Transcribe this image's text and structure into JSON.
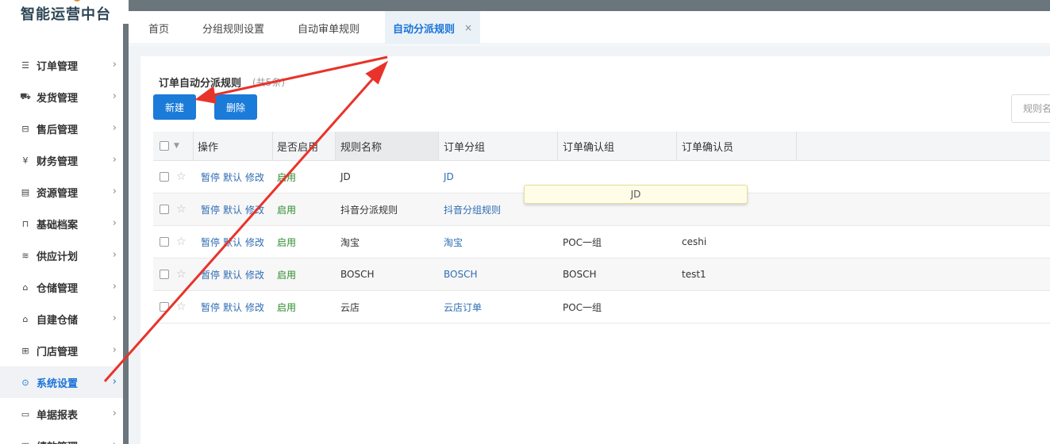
{
  "app": {
    "title": "智能运营中台"
  },
  "sidebar": {
    "items": [
      {
        "label": "订单管理",
        "icon": "order-list-icon",
        "glyph": "☰"
      },
      {
        "label": "发货管理",
        "icon": "truck-icon",
        "glyph": "⛟"
      },
      {
        "label": "售后管理",
        "icon": "after-sales-icon",
        "glyph": "⊟"
      },
      {
        "label": "财务管理",
        "icon": "yen-icon",
        "glyph": "¥"
      },
      {
        "label": "资源管理",
        "icon": "resource-icon",
        "glyph": "▤"
      },
      {
        "label": "基础档案",
        "icon": "archive-box-icon",
        "glyph": "⊓"
      },
      {
        "label": "供应计划",
        "icon": "supply-icon",
        "glyph": "≋"
      },
      {
        "label": "仓储管理",
        "icon": "warehouse-icon",
        "glyph": "⌂"
      },
      {
        "label": "自建仓储",
        "icon": "self-warehouse-icon",
        "glyph": "⌂"
      },
      {
        "label": "门店管理",
        "icon": "store-icon",
        "glyph": "⊞"
      },
      {
        "label": "系统设置",
        "icon": "settings-circle-icon",
        "glyph": "⊙",
        "active": true
      },
      {
        "label": "单据报表",
        "icon": "report-icon",
        "glyph": "▭"
      },
      {
        "label": "绩效管理",
        "icon": "performance-icon",
        "glyph": "◫"
      }
    ]
  },
  "tabs": [
    {
      "label": "首页"
    },
    {
      "label": "分组规则设置"
    },
    {
      "label": "自动审单规则"
    },
    {
      "label": "自动分派规则",
      "active": true,
      "close": "×"
    }
  ],
  "panel": {
    "title": "订单自动分派规则",
    "count": "(共5条)",
    "new_button": "新建",
    "delete_button": "删除",
    "search_placeholder": "规则名称"
  },
  "table": {
    "columns": [
      "操作",
      "是否启用",
      "规则名称",
      "订单分组",
      "订单确认组",
      "订单确认员"
    ],
    "actions": [
      "暂停",
      "默认",
      "修改"
    ],
    "rows": [
      {
        "enabled": "启用",
        "name": "JD",
        "group": "JD",
        "confirm_group": "",
        "confirmer": ""
      },
      {
        "enabled": "启用",
        "name": "抖音分派规则",
        "group": "抖音分组规则",
        "confirm_group": "",
        "confirmer": ""
      },
      {
        "enabled": "启用",
        "name": "淘宝",
        "group": "淘宝",
        "confirm_group": "POC一组",
        "confirmer": "ceshi"
      },
      {
        "enabled": "启用",
        "name": "BOSCH",
        "group": "BOSCH",
        "confirm_group": "BOSCH",
        "confirmer": "test1"
      },
      {
        "enabled": "启用",
        "name": "云店",
        "group": "云店订单",
        "confirm_group": "POC一组",
        "confirmer": ""
      }
    ]
  },
  "tooltip": {
    "text": "JD"
  },
  "colors": {
    "accent": "#1a7bd9",
    "annotation_arrow": "#e8332a",
    "enabled_green": "#2e8b2e"
  }
}
